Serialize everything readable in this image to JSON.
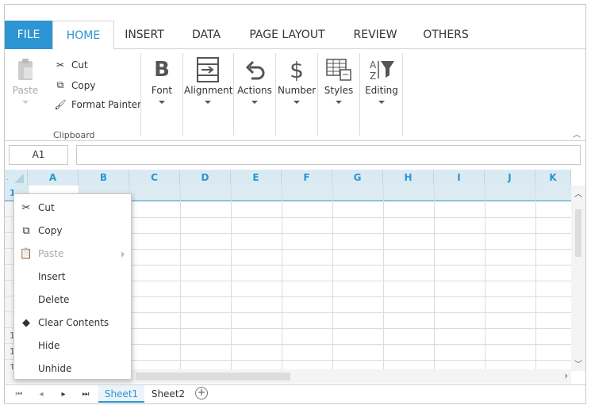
{
  "tabs": {
    "file": "FILE",
    "items": [
      "HOME",
      "INSERT",
      "DATA",
      "PAGE LAYOUT",
      "REVIEW",
      "OTHERS"
    ],
    "active": "HOME"
  },
  "ribbon": {
    "paste": "Paste",
    "cut": "Cut",
    "copy": "Copy",
    "format_painter": "Format Painter",
    "clipboard_group": "Clipboard",
    "font": "Font",
    "alignment": "Alignment",
    "actions": "Actions",
    "number": "Number",
    "styles": "Styles",
    "editing": "Editing"
  },
  "formula_bar": {
    "name_box": "A1",
    "formula": ""
  },
  "grid": {
    "columns": [
      "A",
      "B",
      "C",
      "D",
      "E",
      "F",
      "G",
      "H",
      "I",
      "J",
      "K"
    ],
    "visible_rows": [
      "1",
      "",
      "",
      "",
      "",
      "",
      "",
      "",
      "",
      "1",
      "1",
      "1"
    ]
  },
  "context_menu": {
    "items": [
      {
        "label": "Cut",
        "icon": "scissors-icon",
        "enabled": true
      },
      {
        "label": "Copy",
        "icon": "copy-icon",
        "enabled": true
      },
      {
        "label": "Paste",
        "icon": "clipboard-icon",
        "enabled": false
      },
      {
        "label": "Insert",
        "icon": "",
        "enabled": true
      },
      {
        "label": "Delete",
        "icon": "",
        "enabled": true
      },
      {
        "label": "Clear Contents",
        "icon": "eraser-icon",
        "enabled": true
      },
      {
        "label": "Hide",
        "icon": "",
        "enabled": true
      },
      {
        "label": "Unhide",
        "icon": "",
        "enabled": true
      }
    ]
  },
  "sheets": {
    "items": [
      "Sheet1",
      "Sheet2"
    ],
    "active": "Sheet1"
  },
  "colors": {
    "accent": "#2d95d3",
    "header_bg": "#daeaf2"
  }
}
